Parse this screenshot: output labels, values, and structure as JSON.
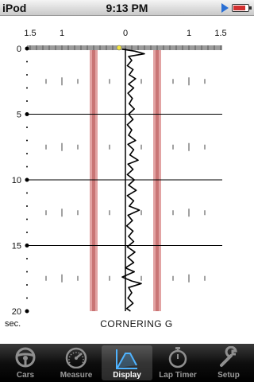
{
  "status_bar": {
    "carrier": "iPod",
    "time": "9:13 PM"
  },
  "chart_data": {
    "type": "line",
    "title": "CORNERING G",
    "x_ticks": [
      "1.5",
      "1",
      "0",
      "1",
      "1.5"
    ],
    "y_ticks": [
      "0",
      "5",
      "10",
      "15",
      "20"
    ],
    "y_unit": "sec.",
    "xlim": [
      -1.5,
      1.5
    ],
    "ylim": [
      0,
      20
    ],
    "threshold_bands": [
      -0.5,
      0.5
    ],
    "marker": {
      "g": -0.1,
      "t": 0.0
    },
    "series": [
      {
        "points": [
          [
            -0.05,
            0.05
          ],
          [
            0.15,
            0.2
          ],
          [
            0.3,
            0.4
          ],
          [
            0.05,
            0.6
          ],
          [
            0.1,
            0.9
          ],
          [
            0.03,
            1.3
          ],
          [
            0.12,
            1.6
          ],
          [
            0.06,
            2.0
          ],
          [
            0.16,
            2.3
          ],
          [
            0.05,
            2.7
          ],
          [
            0.13,
            3.0
          ],
          [
            0.04,
            3.4
          ],
          [
            0.11,
            3.8
          ],
          [
            0.06,
            4.2
          ],
          [
            0.14,
            4.6
          ],
          [
            0.05,
            5.0
          ],
          [
            0.12,
            5.4
          ],
          [
            0.03,
            5.8
          ],
          [
            0.1,
            6.2
          ],
          [
            0.05,
            6.6
          ],
          [
            0.16,
            7.0
          ],
          [
            0.04,
            7.3
          ],
          [
            0.13,
            7.7
          ],
          [
            0.07,
            8.1
          ],
          [
            0.2,
            8.5
          ],
          [
            0.04,
            8.8
          ],
          [
            0.12,
            9.2
          ],
          [
            0.03,
            9.6
          ],
          [
            0.14,
            10.0
          ],
          [
            0.05,
            10.4
          ],
          [
            0.17,
            10.8
          ],
          [
            0.03,
            11.2
          ],
          [
            0.13,
            11.6
          ],
          [
            0.06,
            12.0
          ],
          [
            0.22,
            12.3
          ],
          [
            0.04,
            12.7
          ],
          [
            0.11,
            13.1
          ],
          [
            0.02,
            13.5
          ],
          [
            0.12,
            13.9
          ],
          [
            0.05,
            14.3
          ],
          [
            0.13,
            14.7
          ],
          [
            0.03,
            15.1
          ],
          [
            0.15,
            15.5
          ],
          [
            0.04,
            15.9
          ],
          [
            0.13,
            16.3
          ],
          [
            0.0,
            16.7
          ],
          [
            0.14,
            17.0
          ],
          [
            -0.05,
            17.4
          ],
          [
            0.1,
            17.7
          ],
          [
            0.25,
            17.9
          ],
          [
            0.05,
            18.2
          ],
          [
            0.1,
            18.6
          ],
          [
            0.04,
            19.0
          ],
          [
            0.12,
            19.4
          ],
          [
            0.02,
            19.8
          ],
          [
            0.08,
            20.0
          ]
        ]
      }
    ]
  },
  "tab_bar": {
    "items": [
      {
        "label": "Cars",
        "icon": "steering-wheel-icon"
      },
      {
        "label": "Measure",
        "icon": "gauge-icon"
      },
      {
        "label": "Display",
        "icon": "chart-icon",
        "selected": true
      },
      {
        "label": "Lap Timer",
        "icon": "stopwatch-icon"
      },
      {
        "label": "Setup",
        "icon": "wrench-icon"
      }
    ]
  }
}
